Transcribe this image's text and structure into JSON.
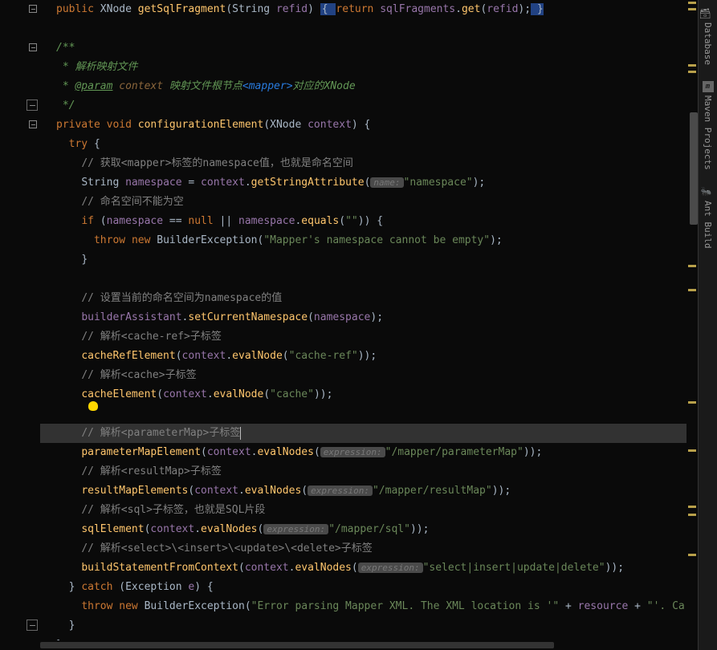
{
  "sidebar": {
    "database": "Database",
    "maven": "Maven Projects",
    "ant": "Ant Build"
  },
  "code": {
    "line0_public": "public",
    "line0_type": "XNode",
    "line0_method": "getSqlFragment",
    "line0_paramtype": "String",
    "line0_param": "refid",
    "line0_return": "return",
    "line0_var": "sqlFragments",
    "line0_call": "get",
    "line0_arg": "refid",
    "doc1": "/**",
    "doc2": " * 解析映射文件",
    "doc3_star": " * ",
    "doc3_tag": "@param",
    "doc3_param": " context",
    "doc3_text": " 映射文件根节点",
    "doc3_xml": "<mapper>",
    "doc3_text2": "对应的XNode",
    "doc4": " */",
    "line_private": "private",
    "line_void": "void",
    "line_method": "configurationElement",
    "line_paramtype": "XNode",
    "line_param": "context",
    "line_try": "try",
    "c1": "// 获取<mapper>标签的namespace值，也就是命名空间",
    "l_string": "String",
    "l_ns": "namespace",
    "l_ctx": "context",
    "l_getattr": "getStringAttribute",
    "h_name": "name:",
    "s_namespace": "\"namespace\"",
    "c2": "// 命名空间不能为空",
    "l_if": "if",
    "l_null": "null",
    "l_equals": "equals",
    "s_empty": "\"\"",
    "l_throw": "throw",
    "l_new": "new",
    "l_bex": "BuilderException",
    "s_empty_ns": "\"Mapper's namespace cannot be empty\"",
    "c3": "// 设置当前的命名空间为namespace的值",
    "l_ba": "builderAssistant",
    "l_scn": "setCurrentNamespace",
    "c4": "// 解析<cache-ref>子标签",
    "l_cre": "cacheRefElement",
    "l_evalnode": "evalNode",
    "s_cacheref": "\"cache-ref\"",
    "c5": "// 解析<cache>子标签",
    "l_ce": "cacheElement",
    "s_cache": "\"cache\"",
    "c6": "// 解析<parameterMap>子标签",
    "l_pme": "parameterMapElement",
    "l_evalnodes": "evalNodes",
    "h_expr": "expression:",
    "s_pmap": "\"/mapper/parameterMap\"",
    "c7": "// 解析<resultMap>子标签",
    "l_rme": "resultMapElements",
    "s_rmap": "\"/mapper/resultMap\"",
    "c8": "// 解析<sql>子标签，也就是SQL片段",
    "l_se": "sqlElement",
    "s_sql": "\"/mapper/sql\"",
    "c9": "// 解析<select>\\<insert>\\<update>\\<delete>子标签",
    "l_bsfc": "buildStatementFromContext",
    "s_crud": "\"select|insert|update|delete\"",
    "l_catch": "catch",
    "l_ex": "Exception",
    "l_e": "e",
    "s_err": "\"Error parsing Mapper XML. The XML location is '\"",
    "l_plus": " + ",
    "l_res": "resource",
    "s_err2": "\"'. Ca"
  }
}
